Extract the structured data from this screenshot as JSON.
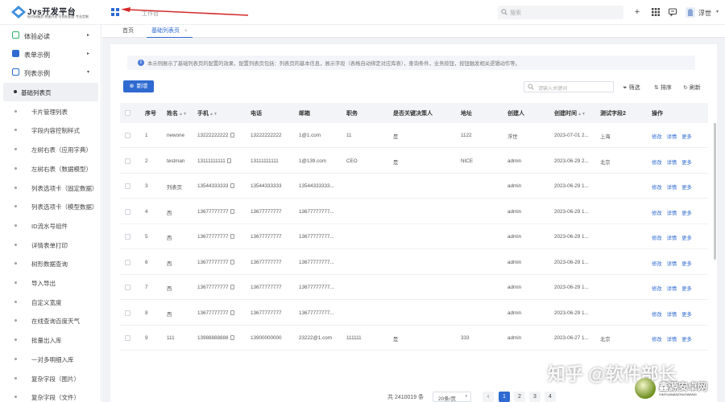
{
  "header": {
    "logo_title": "Jvs开发平台",
    "logo_subtitle": "低代码服务·快速开发·可视化配置·专业定制",
    "breadcrumb": "工作台",
    "search_placeholder": "搜索",
    "username": "浮世",
    "icons": [
      "plus-icon",
      "grid-icon",
      "message-icon"
    ]
  },
  "sidebar": {
    "groups": [
      {
        "label": "体验必读",
        "icon": "book-icon",
        "color": "#2fb26a",
        "arrow": "▸"
      },
      {
        "label": "表单示例",
        "icon": "form-icon",
        "color": "#2e6ad1",
        "arrow": "▸"
      },
      {
        "label": "列表示例",
        "icon": "list-icon",
        "color": "#2e6ad1",
        "arrow": "▾"
      }
    ],
    "items": [
      {
        "label": "基础列表页",
        "active": true
      },
      {
        "label": "卡片管理列表"
      },
      {
        "label": "字段内容控制样式"
      },
      {
        "label": "左树右表（应用字典）"
      },
      {
        "label": "左树右表（数据模型）"
      },
      {
        "label": "列表选项卡（固定数据）"
      },
      {
        "label": "列表选项卡（模型数据）"
      },
      {
        "label": "ID流水号组件"
      },
      {
        "label": "详情表单打印"
      },
      {
        "label": "树形数据查询"
      },
      {
        "label": "导入导出"
      },
      {
        "label": "自定义宽度"
      },
      {
        "label": "在线查询百度天气"
      },
      {
        "label": "批量出入库"
      },
      {
        "label": "一对多明细入库"
      },
      {
        "label": "复杂字段（图片）"
      },
      {
        "label": "复杂字段（文件）"
      }
    ]
  },
  "tabs": [
    {
      "label": "首页"
    },
    {
      "label": "基础列表页",
      "close": "×",
      "active": true
    }
  ],
  "notice": "本示例展示了基础列表页的配置的效果，配置列表页包括：列表页的基本信息，展示字段（表格自动绑定对应库表），查询条件，业务按钮，按钮触发相关逻辑动作等。",
  "toolbar": {
    "add_label": "新增",
    "add_icon": "⊕",
    "search_placeholder": "请输入关键词",
    "filter_label": "筛选",
    "sort_label": "排序",
    "refresh_label": "刷新"
  },
  "table": {
    "columns": [
      "序号",
      "姓名",
      "手机",
      "电话",
      "邮箱",
      "职务",
      "是否关键决策人",
      "地址",
      "创建人",
      "创建时间",
      "测试字段2",
      "操作"
    ],
    "sortable": [
      false,
      true,
      true,
      false,
      false,
      false,
      false,
      false,
      false,
      true,
      false,
      false
    ],
    "actions": [
      "修改",
      "详情",
      "更多"
    ],
    "rows": [
      {
        "no": "1",
        "name": "newone",
        "mobile": "13222222222",
        "phone": "13222222222",
        "email": "1@1.com",
        "title": "11",
        "key": "是",
        "addr": "1122",
        "creator": "浮世",
        "created": "2023-07-01 2...",
        "f2": "上海"
      },
      {
        "no": "2",
        "name": "testman",
        "mobile": "13111111111",
        "phone": "13111111111",
        "email": "1@139.com",
        "title": "CEO",
        "key": "是",
        "addr": "NICE",
        "creator": "admin",
        "created": "2023-06-29 2...",
        "f2": "北京"
      },
      {
        "no": "3",
        "name": "列表页",
        "mobile": "13544333333",
        "phone": "13544333333",
        "email": "13544333333...",
        "title": "",
        "key": "",
        "addr": "",
        "creator": "admin",
        "created": "2023-06-29 1...",
        "f2": ""
      },
      {
        "no": "4",
        "name": "西",
        "mobile": "13677777777",
        "phone": "13677777777",
        "email": "13677777777...",
        "title": "",
        "key": "",
        "addr": "",
        "creator": "admin",
        "created": "2023-06-29 1...",
        "f2": ""
      },
      {
        "no": "5",
        "name": "西",
        "mobile": "13677777777",
        "phone": "13677777777",
        "email": "13677777777...",
        "title": "",
        "key": "",
        "addr": "",
        "creator": "admin",
        "created": "2023-06-29 1...",
        "f2": ""
      },
      {
        "no": "6",
        "name": "西",
        "mobile": "13677777777",
        "phone": "13677777777",
        "email": "13677777777...",
        "title": "",
        "key": "",
        "addr": "",
        "creator": "admin",
        "created": "2023-06-29 1...",
        "f2": ""
      },
      {
        "no": "7",
        "name": "西",
        "mobile": "13677777777",
        "phone": "13677777777",
        "email": "13677777777...",
        "title": "",
        "key": "",
        "addr": "",
        "creator": "admin",
        "created": "2023-06-29 1...",
        "f2": ""
      },
      {
        "no": "8",
        "name": "西",
        "mobile": "13677777777",
        "phone": "13677777777",
        "email": "13677777777...",
        "title": "",
        "key": "",
        "addr": "",
        "creator": "admin",
        "created": "2023-06-29 1...",
        "f2": ""
      },
      {
        "no": "9",
        "name": "111",
        "mobile": "13988888888",
        "phone": "13900000000",
        "email": "23222@1.com",
        "title": "111111",
        "key": "是",
        "addr": "333",
        "creator": "admin",
        "created": "2023-06-27 1...",
        "f2": "北京"
      }
    ]
  },
  "pagination": {
    "total": "共 2410019 条",
    "page_size": "20条/页",
    "prev": "‹",
    "pages": [
      "1",
      "2",
      "3",
      "4"
    ],
    "current": "1"
  },
  "overlay": {
    "watermark": "知乎 @软件部长",
    "site_name": "鑫源安卓网",
    "site_domain": "XINYUANANZHUOWANG"
  },
  "colors": {
    "accent": "#2e6ad1",
    "sidebar_active_bg": "#eef0f4",
    "annotation_arrow": "#d42a2a"
  }
}
